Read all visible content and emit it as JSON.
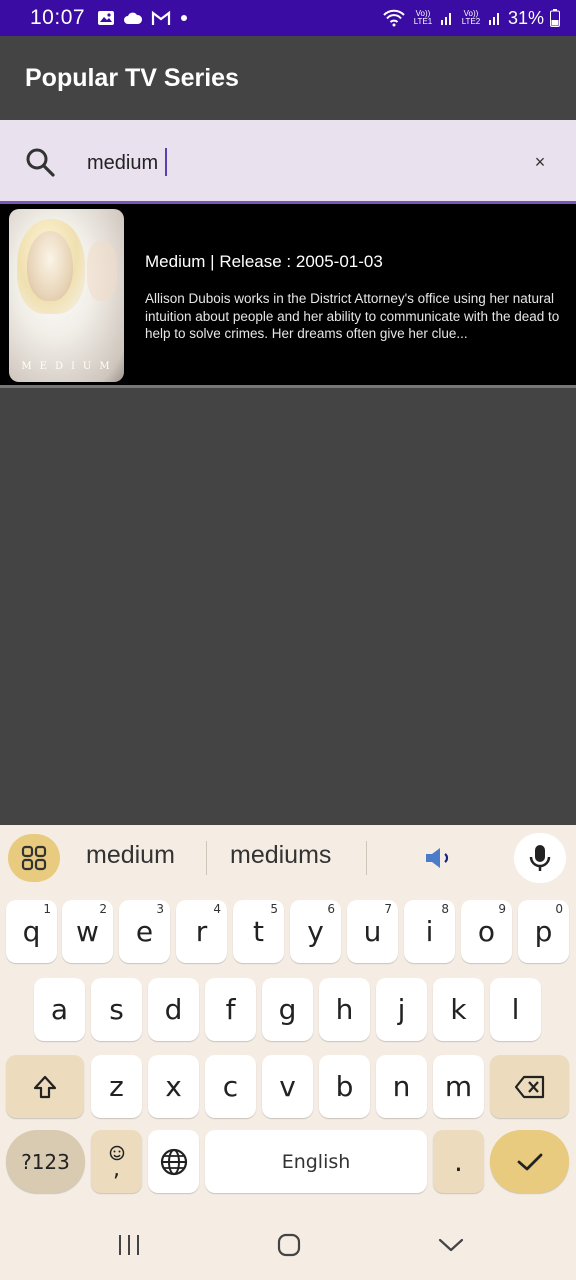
{
  "status": {
    "time": "10:07",
    "battery": "31%",
    "sim1": "Vo)) LTE1",
    "sim2": "Vo)) LTE2",
    "notification_icons": [
      "gallery-icon",
      "cloud-icon",
      "gmail-icon",
      "dot-icon"
    ]
  },
  "app_bar": {
    "title": "Popular TV Series"
  },
  "search": {
    "value": "medium",
    "clear_label": "×"
  },
  "results": [
    {
      "poster_text": "MEDIUM",
      "title": "Medium | Release : 2005-01-03",
      "description": "Allison Dubois works in the District Attorney's office using her natural intuition about people and her ability to communicate with the dead to help to solve crimes. Her dreams often give her clue..."
    }
  ],
  "keyboard": {
    "suggestions": [
      "medium",
      "mediums"
    ],
    "row1": [
      {
        "key": "q",
        "hint": "1"
      },
      {
        "key": "w",
        "hint": "2"
      },
      {
        "key": "e",
        "hint": "3"
      },
      {
        "key": "r",
        "hint": "4"
      },
      {
        "key": "t",
        "hint": "5"
      },
      {
        "key": "y",
        "hint": "6"
      },
      {
        "key": "u",
        "hint": "7"
      },
      {
        "key": "i",
        "hint": "8"
      },
      {
        "key": "o",
        "hint": "9"
      },
      {
        "key": "p",
        "hint": "0"
      }
    ],
    "row2": [
      "a",
      "s",
      "d",
      "f",
      "g",
      "h",
      "j",
      "k",
      "l"
    ],
    "row3": [
      "z",
      "x",
      "c",
      "v",
      "b",
      "n",
      "m"
    ],
    "symbols_label": "?123",
    "comma_label": ",",
    "space_label": "English",
    "period_label": "."
  },
  "colors": {
    "status_bar": "#3a0ca3",
    "app_bg": "#444444",
    "search_bg": "#e9e1ee",
    "accent": "#7b55c0",
    "keyboard_bg": "#f5ede4",
    "key_accent": "#e8cb7e"
  }
}
